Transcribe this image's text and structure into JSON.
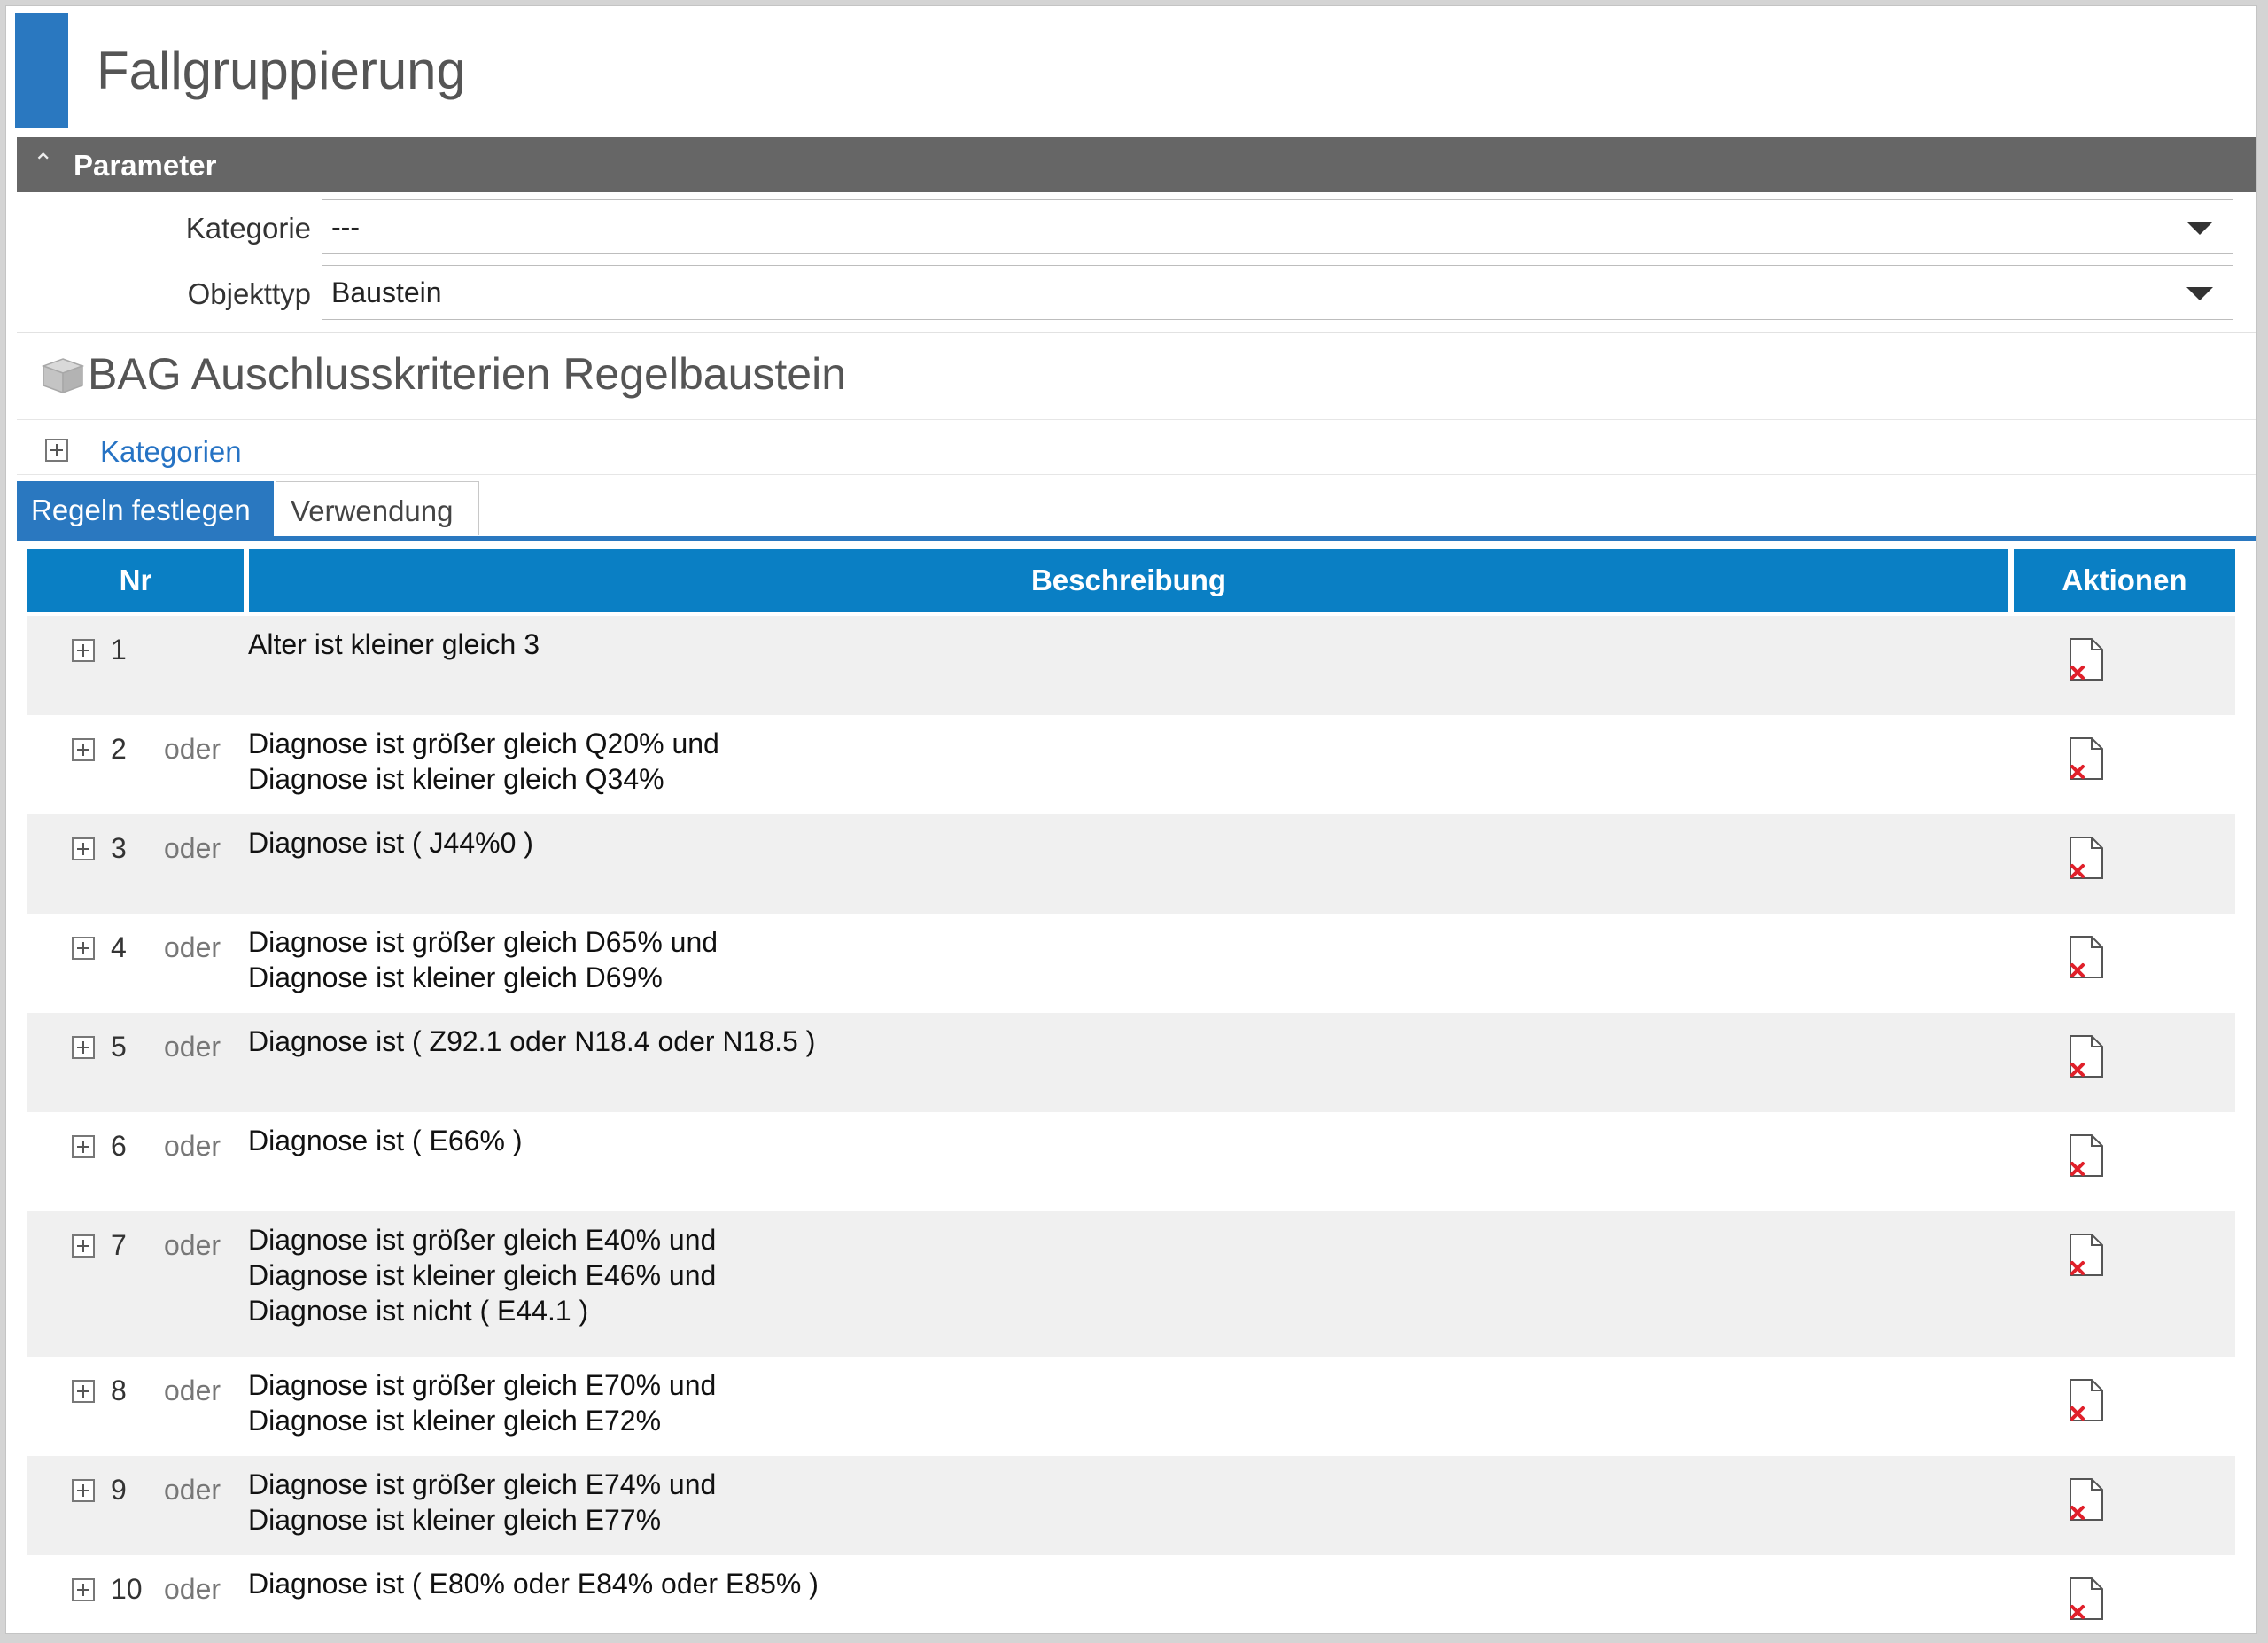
{
  "page": {
    "title": "Fallgruppierung"
  },
  "parameter": {
    "header": "Parameter",
    "fields": [
      {
        "label": "Kategorie",
        "value": "---"
      },
      {
        "label": "Objekttyp",
        "value": "Baustein"
      }
    ]
  },
  "object": {
    "title": "BAG Auschlusskriterien Regelbaustein",
    "categories_link": "Kategorien"
  },
  "tabs": [
    {
      "label": "Regeln festlegen",
      "active": true
    },
    {
      "label": "Verwendung",
      "active": false
    }
  ],
  "table": {
    "columns": [
      "Nr",
      "Beschreibung",
      "Aktionen"
    ],
    "rows": [
      {
        "nr": "1",
        "op": "",
        "lines": [
          "Alter ist  kleiner gleich 3"
        ]
      },
      {
        "nr": "2",
        "op": "oder",
        "lines": [
          "Diagnose ist  größer gleich Q20% und",
          "Diagnose ist  kleiner gleich Q34%"
        ]
      },
      {
        "nr": "3",
        "op": "oder",
        "lines": [
          "Diagnose ist  ( J44%0 )"
        ]
      },
      {
        "nr": "4",
        "op": "oder",
        "lines": [
          "Diagnose ist  größer gleich D65% und",
          "Diagnose ist  kleiner gleich D69%"
        ]
      },
      {
        "nr": "5",
        "op": "oder",
        "lines": [
          "Diagnose ist  ( Z92.1 oder N18.4 oder N18.5 )"
        ]
      },
      {
        "nr": "6",
        "op": "oder",
        "lines": [
          "Diagnose ist  ( E66% )"
        ]
      },
      {
        "nr": "7",
        "op": "oder",
        "lines": [
          "Diagnose ist  größer gleich E40% und",
          "Diagnose ist  kleiner gleich E46% und",
          "Diagnose ist nicht ( E44.1 )"
        ]
      },
      {
        "nr": "8",
        "op": "oder",
        "lines": [
          "Diagnose ist  größer gleich E70% und",
          "Diagnose ist  kleiner gleich E72%"
        ]
      },
      {
        "nr": "9",
        "op": "oder",
        "lines": [
          "Diagnose ist  größer gleich E74% und",
          "Diagnose ist  kleiner gleich E77%"
        ]
      },
      {
        "nr": "10",
        "op": "oder",
        "lines": [
          "Diagnose ist  ( E80% oder E84% oder E85% )"
        ]
      }
    ]
  },
  "icons": {
    "collapse": "chevron-up-icon",
    "expand": "plus-box-icon",
    "object": "cube-icon",
    "delete": "delete-document-icon"
  },
  "colors": {
    "accent": "#2a78c0",
    "table_header": "#0a7fc4",
    "section_header": "#666666",
    "row_shade": "#f0f0f0",
    "delete_x": "#e0202a"
  }
}
